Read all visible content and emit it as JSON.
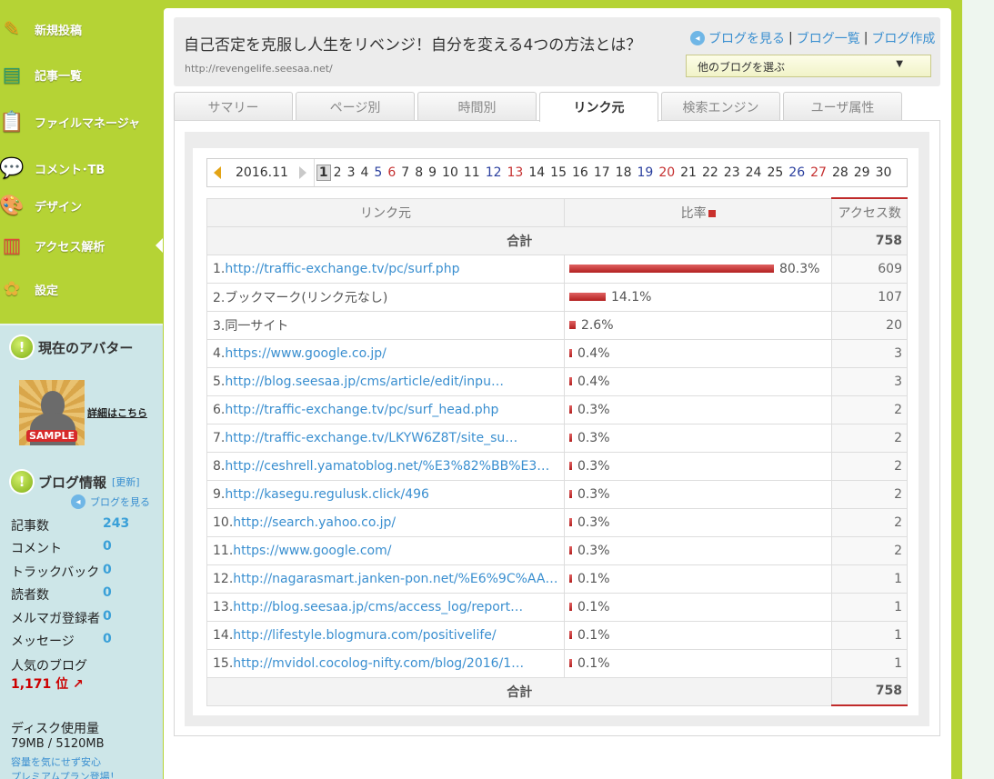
{
  "sidebar": {
    "nav": [
      {
        "label": "新規投稿",
        "icon": "pencil-icon"
      },
      {
        "label": "記事一覧",
        "icon": "document-list-icon"
      },
      {
        "label": "ファイルマネージャ",
        "icon": "clipboard-icon"
      },
      {
        "label": "コメント･TB",
        "icon": "speech-bubble-icon"
      },
      {
        "label": "デザイン",
        "icon": "palette-icon"
      },
      {
        "label": "アクセス解析",
        "icon": "bar-chart-icon"
      },
      {
        "label": "設定",
        "icon": "flower-gear-icon"
      }
    ],
    "avatar_title": "現在のアバター",
    "avatar_sample": "SAMPLE",
    "avatar_detail": "詳細はこちら",
    "blog_info_title": "ブログ情報",
    "blog_info_update": "[更新]",
    "view_blog": "ブログを見る",
    "stats": [
      {
        "label": "記事数",
        "value": "243"
      },
      {
        "label": "コメント",
        "value": "0"
      },
      {
        "label": "トラックバック",
        "value": "0"
      },
      {
        "label": "読者数",
        "value": "0"
      },
      {
        "label": "メルマガ登録者",
        "value": "0"
      },
      {
        "label": "メッセージ",
        "value": "0"
      }
    ],
    "popular_label": "人気のブログ",
    "popular_rank": "1,171 位",
    "disk_label": "ディスク使用量",
    "disk_value": "79MB / 5120MB",
    "disk_note1": "容量を気にせず安心",
    "disk_note2": "プレミアムプラン登場！"
  },
  "header": {
    "title": "自己否定を克服し人生をリベンジ！自分を変える4つの方法とは？",
    "url": "http://revengelife.seesaa.net/",
    "link_view": "ブログを見る",
    "link_list": "ブログ一覧",
    "link_create": "ブログ作成",
    "sep": "|",
    "select_label": "他のブログを選ぶ"
  },
  "tabs": [
    "サマリー",
    "ページ別",
    "時間別",
    "リンク元",
    "検索エンジン",
    "ユーザ属性"
  ],
  "date_bar": {
    "month": "2016.11",
    "days": [
      "1",
      "2",
      "3",
      "4",
      "5",
      "6",
      "7",
      "8",
      "9",
      "10",
      "11",
      "12",
      "13",
      "14",
      "15",
      "16",
      "17",
      "18",
      "19",
      "20",
      "21",
      "22",
      "23",
      "24",
      "25",
      "26",
      "27",
      "28",
      "29",
      "30"
    ],
    "selected": "1",
    "saturdays": [
      "5",
      "12",
      "19",
      "26"
    ],
    "sundays": [
      "6",
      "13",
      "20",
      "27"
    ]
  },
  "table": {
    "col_source": "リンク元",
    "col_ratio": "比率",
    "col_access": "アクセス数",
    "total_label": "合計",
    "total_value": "758",
    "rows": [
      {
        "num": "1.",
        "src": "http://traffic-exchange.tv/pc/surf.php",
        "link": true,
        "pct": "80.3%",
        "ratio": 0.803,
        "count": "609"
      },
      {
        "num": "2.",
        "src": "ブックマーク(リンク元なし)",
        "link": false,
        "pct": "14.1%",
        "ratio": 0.141,
        "count": "107"
      },
      {
        "num": "3.",
        "src": "同一サイト",
        "link": false,
        "pct": "2.6%",
        "ratio": 0.026,
        "count": "20"
      },
      {
        "num": "4.",
        "src": "https://www.google.co.jp/",
        "link": true,
        "pct": "0.4%",
        "ratio": 0.004,
        "count": "3"
      },
      {
        "num": "5.",
        "src": "http://blog.seesaa.jp/cms/article/edit/inpu…",
        "link": true,
        "pct": "0.4%",
        "ratio": 0.004,
        "count": "3"
      },
      {
        "num": "6.",
        "src": "http://traffic-exchange.tv/pc/surf_head.php",
        "link": true,
        "pct": "0.3%",
        "ratio": 0.003,
        "count": "2"
      },
      {
        "num": "7.",
        "src": "http://traffic-exchange.tv/LKYW6Z8T/site_su…",
        "link": true,
        "pct": "0.3%",
        "ratio": 0.003,
        "count": "2"
      },
      {
        "num": "8.",
        "src": "http://ceshrell.yamatoblog.net/%E3%82%BB%E3…",
        "link": true,
        "pct": "0.3%",
        "ratio": 0.003,
        "count": "2"
      },
      {
        "num": "9.",
        "src": "http://kasegu.regulusk.click/496",
        "link": true,
        "pct": "0.3%",
        "ratio": 0.003,
        "count": "2"
      },
      {
        "num": "10.",
        "src": "http://search.yahoo.co.jp/",
        "link": true,
        "pct": "0.3%",
        "ratio": 0.003,
        "count": "2"
      },
      {
        "num": "11.",
        "src": "https://www.google.com/",
        "link": true,
        "pct": "0.3%",
        "ratio": 0.003,
        "count": "2"
      },
      {
        "num": "12.",
        "src": "http://nagarasmart.janken-pon.net/%E6%9C%AA…",
        "link": true,
        "pct": "0.1%",
        "ratio": 0.001,
        "count": "1"
      },
      {
        "num": "13.",
        "src": "http://blog.seesaa.jp/cms/access_log/report…",
        "link": true,
        "pct": "0.1%",
        "ratio": 0.001,
        "count": "1"
      },
      {
        "num": "14.",
        "src": "http://lifestyle.blogmura.com/positivelife/",
        "link": true,
        "pct": "0.1%",
        "ratio": 0.001,
        "count": "1"
      },
      {
        "num": "15.",
        "src": "http://mvidol.cocolog-nifty.com/blog/2016/1…",
        "link": true,
        "pct": "0.1%",
        "ratio": 0.001,
        "count": "1"
      }
    ]
  },
  "colors": {
    "sidebar_green": "#b5d335",
    "panel_blue": "#cde6e8",
    "link_blue": "#3a8fd0",
    "bar_red": "#c9302c",
    "stat_blue": "#3aa0d8",
    "rank_red": "#cc0000"
  }
}
